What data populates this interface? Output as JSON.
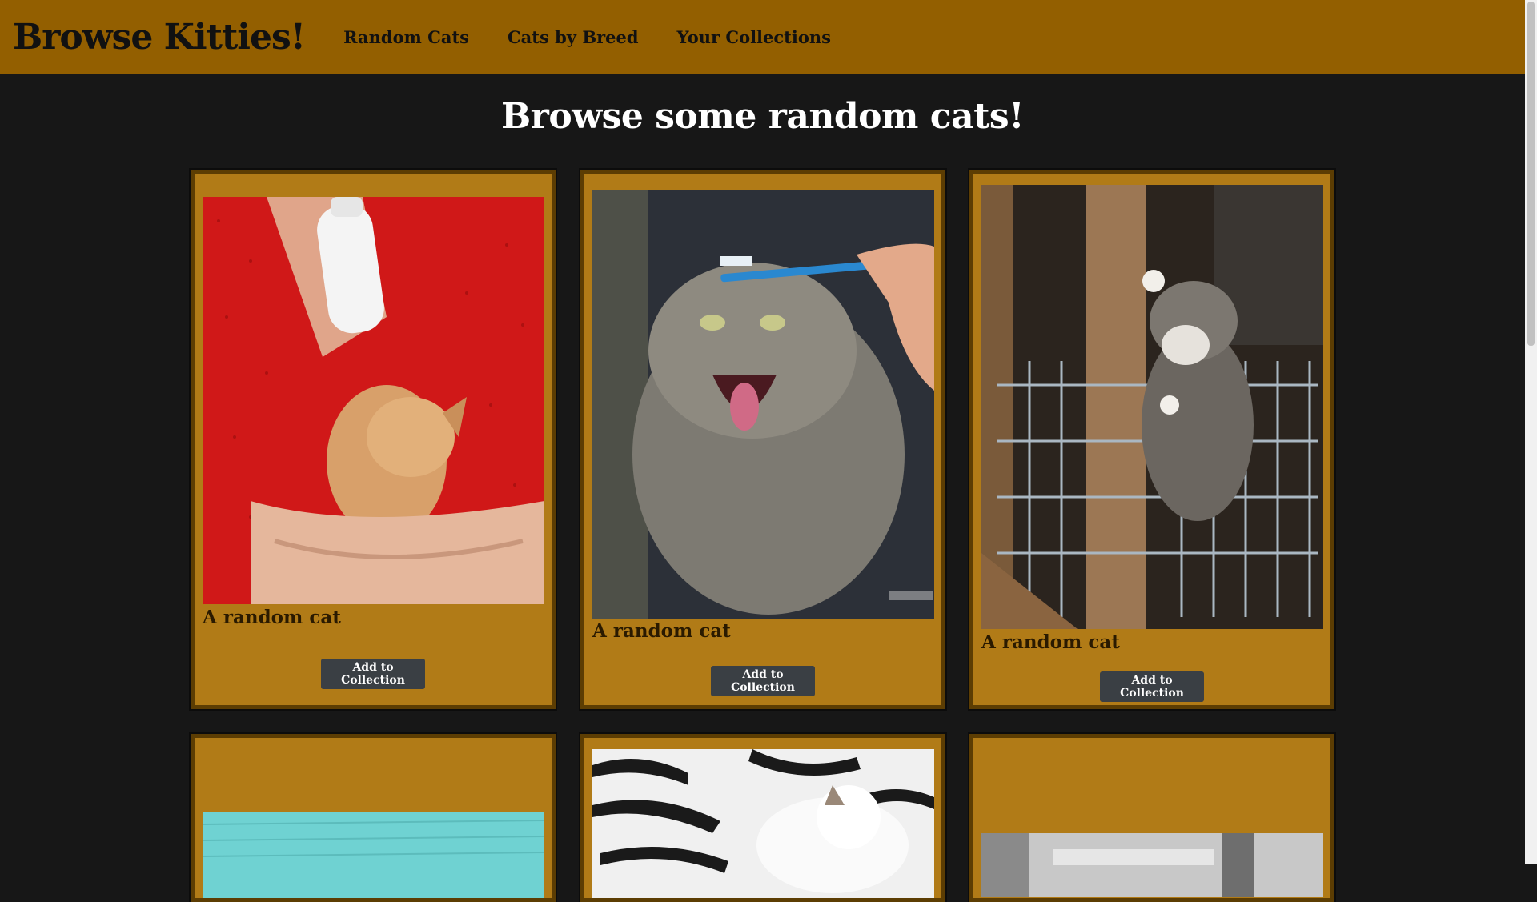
{
  "navbar": {
    "brand": "Browse Kitties!",
    "links": [
      "Random Cats",
      "Cats by Breed",
      "Your Collections"
    ]
  },
  "page": {
    "heading": "Browse some random cats!"
  },
  "cards": [
    {
      "caption": "A random cat",
      "button": "Add to Collection",
      "image": "kitten-bottle-feeding-photo"
    },
    {
      "caption": "A random cat",
      "button": "Add to Collection",
      "image": "pallas-cat-toothbrush-photo"
    },
    {
      "caption": "A random cat",
      "button": "Add to Collection",
      "image": "kitten-climbing-cage-photo"
    },
    {
      "image": "cat-on-blue-towel-photo"
    },
    {
      "image": "white-cat-sleeping-zebra-blanket-photo"
    },
    {
      "image": "black-and-white-cat-photo"
    }
  ],
  "colors": {
    "navbar": "#935f00",
    "background": "#171717",
    "card": "#b17b17",
    "button": "#3a3f44"
  }
}
